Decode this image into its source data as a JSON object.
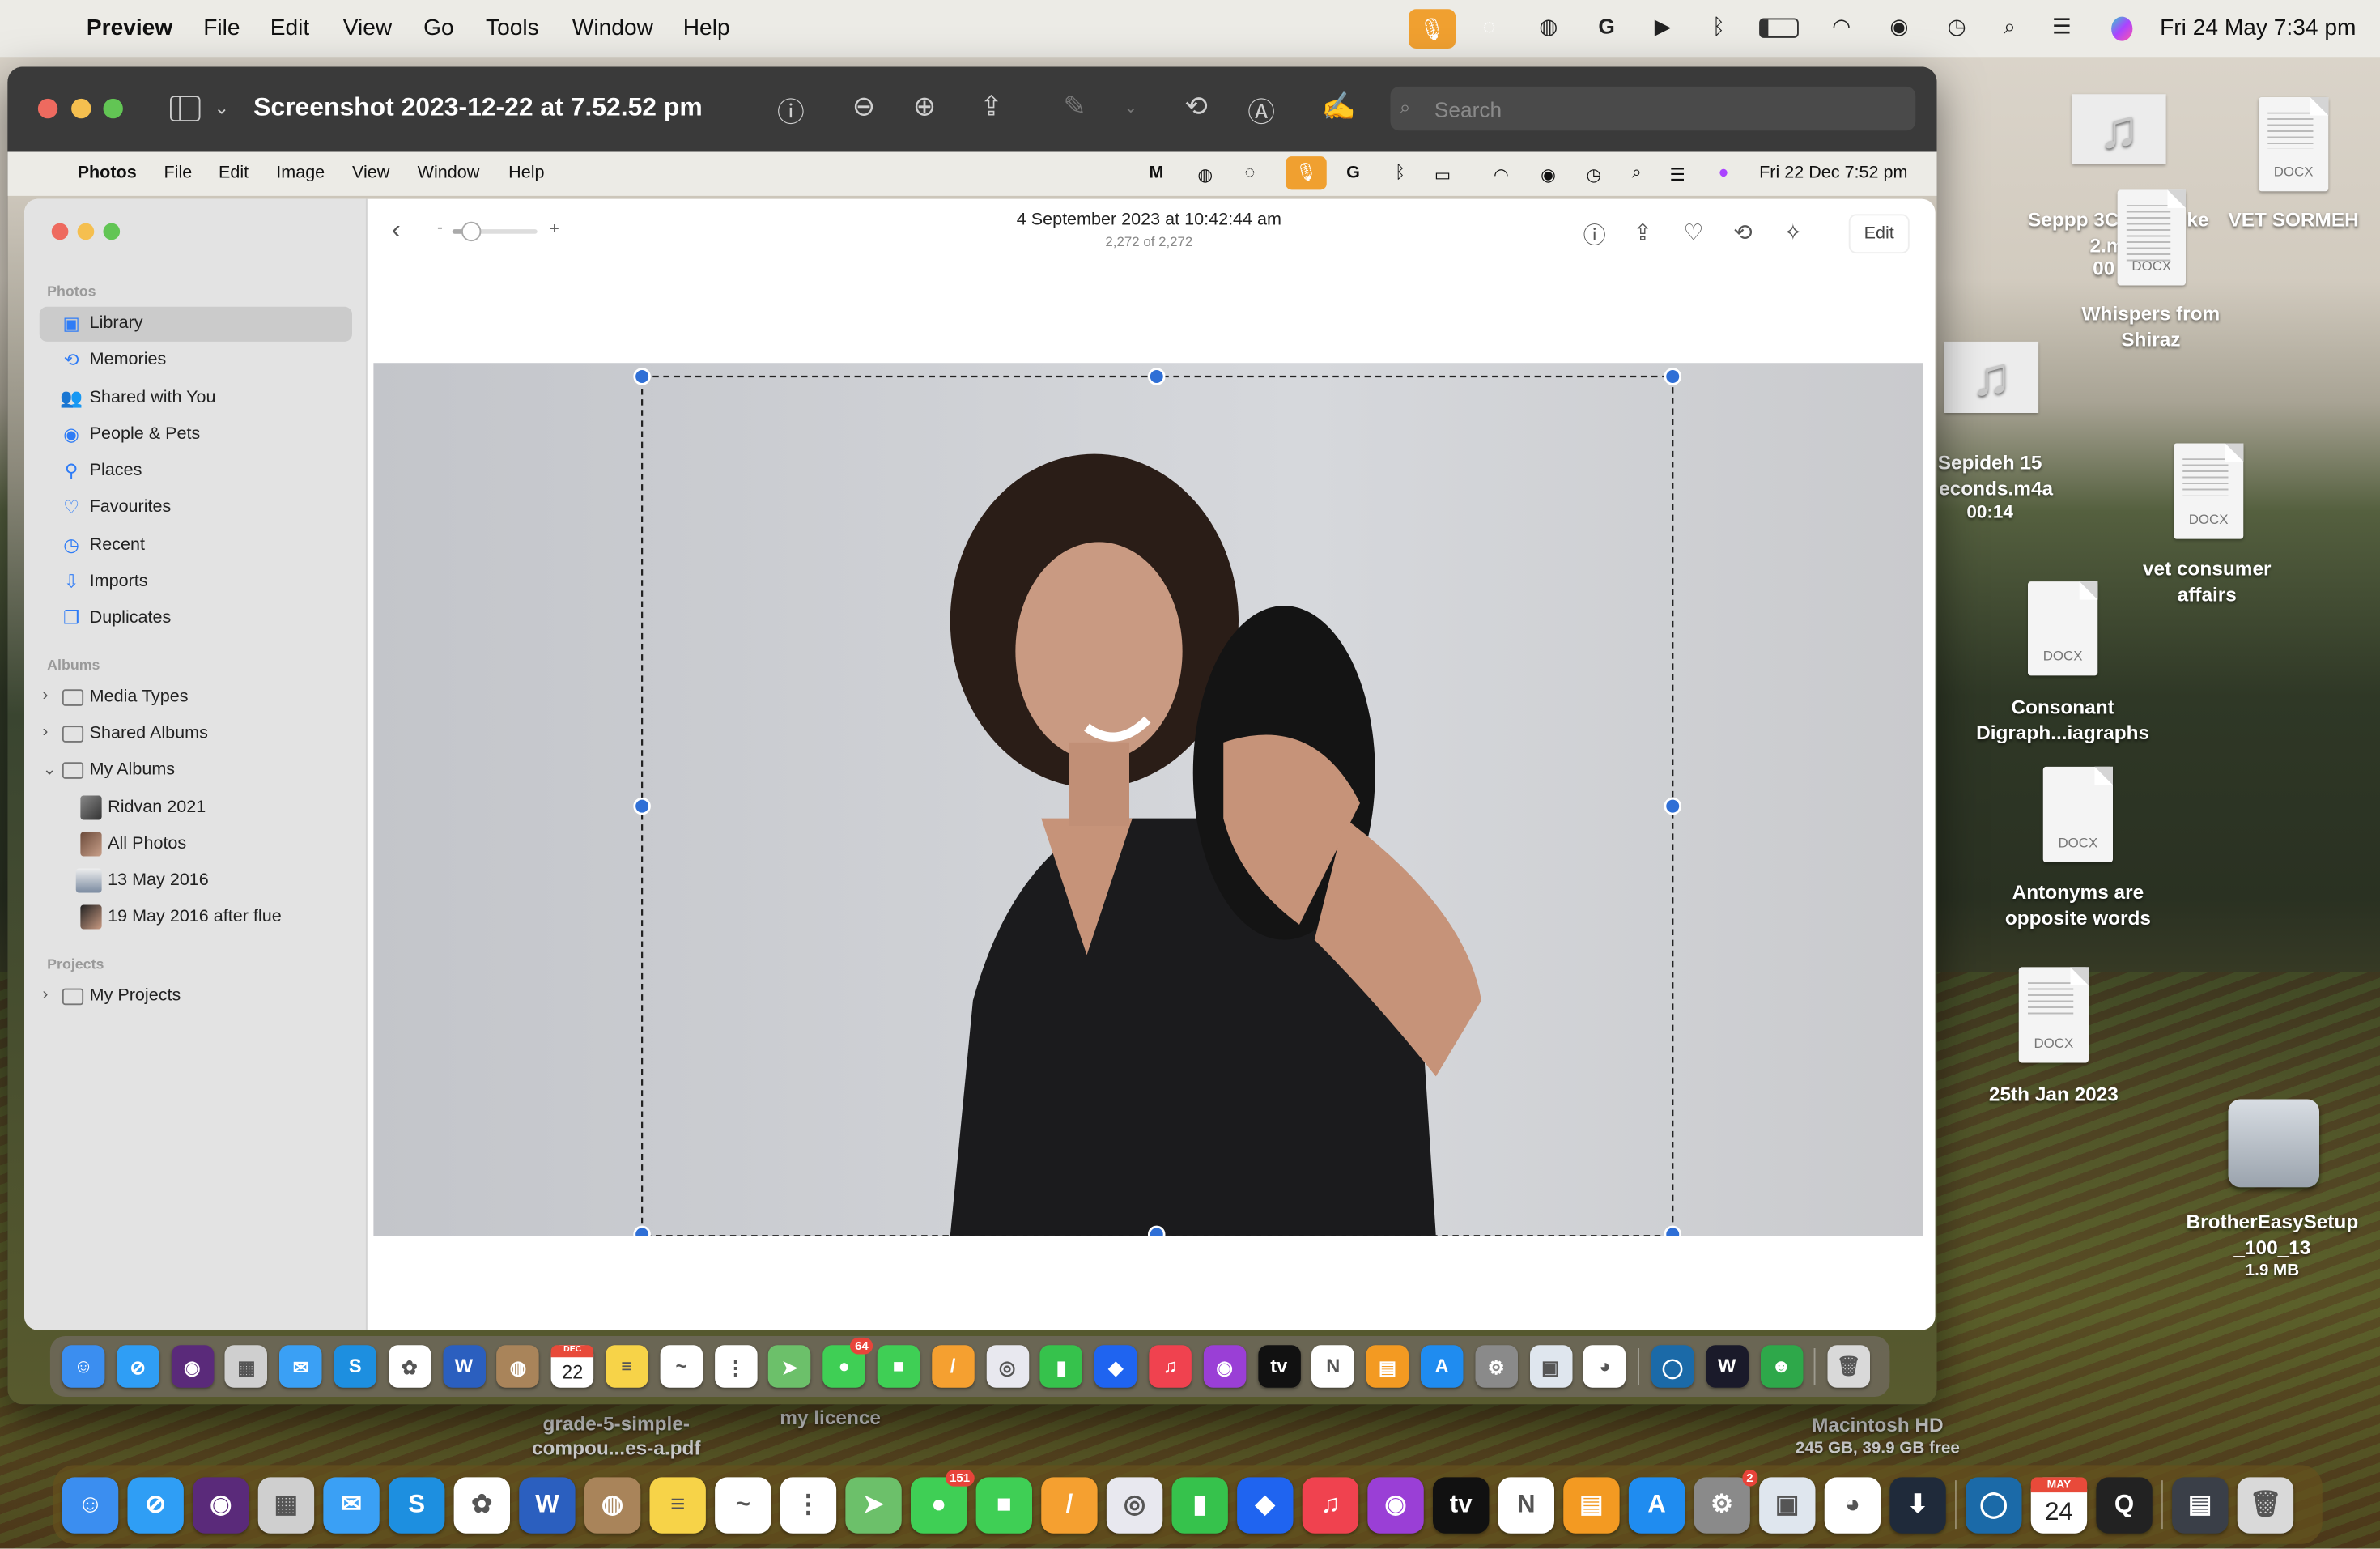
{
  "menubar": {
    "app": "Preview",
    "items": [
      "File",
      "Edit",
      "View",
      "Go",
      "Tools",
      "Window",
      "Help"
    ],
    "clock": "Fri 24 May  7:34 pm",
    "status_icons": [
      "microphone-icon",
      "circle-app-icon",
      "copilot-icon",
      "grammarly-icon",
      "play-icon",
      "bluetooth-icon",
      "battery-icon",
      "wifi-icon",
      "user-icon",
      "time-machine-icon",
      "search-icon",
      "control-center-icon",
      "siri-icon"
    ],
    "accent": "#f0a030"
  },
  "preview": {
    "title": "Screenshot 2023-12-22 at 7.52.52 pm",
    "search_placeholder": "Search",
    "toolbar_icons": [
      "info-icon",
      "zoom-out-icon",
      "zoom-in-icon",
      "share-icon",
      "markup-pen-icon",
      "chevron-down-icon",
      "rotate-icon",
      "annotate-icon",
      "signature-icon"
    ]
  },
  "inner_menubar": {
    "app": "Photos",
    "items": [
      "File",
      "Edit",
      "Image",
      "View",
      "Window",
      "Help"
    ],
    "clock": "Fri 22 Dec  7:52 pm"
  },
  "photos": {
    "header": {
      "date": "4 September 2023 at 10:42:44 am",
      "count": "2,272 of 2,272",
      "zoom_minus": "-",
      "zoom_plus": "+",
      "zoom_level": 0.2,
      "edit_label": "Edit"
    },
    "sidebar": {
      "photos_header": "Photos",
      "items": [
        {
          "label": "Library",
          "icon": "library-icon",
          "selected": true
        },
        {
          "label": "Memories",
          "icon": "memories-icon"
        },
        {
          "label": "Shared with You",
          "icon": "shared-with-you-icon"
        },
        {
          "label": "People & Pets",
          "icon": "people-icon"
        },
        {
          "label": "Places",
          "icon": "places-pin-icon"
        },
        {
          "label": "Favourites",
          "icon": "heart-icon"
        },
        {
          "label": "Recent",
          "icon": "clock-icon"
        },
        {
          "label": "Imports",
          "icon": "import-icon"
        },
        {
          "label": "Duplicates",
          "icon": "duplicates-icon"
        }
      ],
      "albums_header": "Albums",
      "albums": [
        {
          "label": "Media Types"
        },
        {
          "label": "Shared Albums"
        },
        {
          "label": "My Albums",
          "expanded": true
        }
      ],
      "my_albums": [
        {
          "label": "Ridvan 2021"
        },
        {
          "label": "All Photos"
        },
        {
          "label": "13 May 2016"
        },
        {
          "label": "19 May 2016 after flue"
        }
      ],
      "projects_header": "Projects",
      "projects": [
        {
          "label": "My Projects"
        }
      ]
    },
    "selection_color": "#2f6fd6"
  },
  "desktop": {
    "icons": [
      {
        "lines": [
          "Seppp 3C",
          "2.m",
          "00"
        ],
        "suffix": "ke",
        "type": "audio"
      },
      {
        "lines": [
          "VET SORMEH"
        ],
        "type": "docx",
        "badge": "DOCX"
      },
      {
        "lines": [
          "Whispers from",
          "Shiraz"
        ],
        "type": "docx",
        "badge": "DOCX"
      },
      {
        "lines": [
          "Sepideh 15",
          "econds.m4a",
          "00:14"
        ],
        "type": "audio"
      },
      {
        "lines": [
          "vet consumer",
          "affairs"
        ],
        "type": "docx",
        "badge": "DOCX"
      },
      {
        "lines": [
          "Consonant",
          "Digraph...iagraphs"
        ],
        "type": "docx",
        "badge": "DOCX"
      },
      {
        "lines": [
          "Antonyms are",
          "opposite words"
        ],
        "type": "docx",
        "badge": "DOCX"
      },
      {
        "lines": [
          "25th Jan 2023"
        ],
        "type": "docx",
        "badge": "DOCX"
      },
      {
        "lines": [
          "BrotherEasySetup",
          "_100_13",
          "1.9 MB"
        ],
        "type": "disk"
      },
      {
        "lines": [
          "grade-5-simple-",
          "compou...es-a.pdf"
        ],
        "type": "label"
      },
      {
        "lines": [
          "my licence"
        ],
        "type": "label"
      },
      {
        "lines": [
          "Macintosh HD",
          "245 GB, 39.9 GB free"
        ],
        "type": "label"
      }
    ]
  },
  "inner_dock": {
    "apps": [
      {
        "name": "finder",
        "color": "#3b8ef0",
        "glyph": "☺"
      },
      {
        "name": "safari",
        "color": "#2f9ef5",
        "glyph": "⊘"
      },
      {
        "name": "siri",
        "color": "#5a2a7a",
        "glyph": "◉"
      },
      {
        "name": "launchpad",
        "color": "#cfcfcf",
        "glyph": "▦"
      },
      {
        "name": "mail",
        "color": "#3aa0f5",
        "glyph": "✉"
      },
      {
        "name": "skype",
        "color": "#1d8fe0",
        "glyph": "S"
      },
      {
        "name": "photos",
        "color": "#ffffff",
        "glyph": "✿"
      },
      {
        "name": "word",
        "color": "#2b5fbf",
        "glyph": "W"
      },
      {
        "name": "contacts",
        "color": "#a9845a",
        "glyph": "◍"
      },
      {
        "name": "calendar",
        "color": "#ffffff",
        "glyph": "22",
        "top": "DEC"
      },
      {
        "name": "notes",
        "color": "#f7d348",
        "glyph": "≡"
      },
      {
        "name": "freeform",
        "color": "#ffffff",
        "glyph": "~"
      },
      {
        "name": "reminders",
        "color": "#ffffff",
        "glyph": "⋮"
      },
      {
        "name": "maps",
        "color": "#6cc06a",
        "glyph": "➤"
      },
      {
        "name": "messages",
        "color": "#3fcf55",
        "glyph": "●",
        "badge": "64"
      },
      {
        "name": "facetime",
        "color": "#3fcf55",
        "glyph": "■"
      },
      {
        "name": "pages",
        "color": "#f5a030",
        "glyph": "/"
      },
      {
        "name": "circle-app",
        "color": "#e8e8ef",
        "glyph": "◎"
      },
      {
        "name": "numbers",
        "color": "#36c24c",
        "glyph": "▮"
      },
      {
        "name": "dropbox",
        "color": "#1f64f0",
        "glyph": "◆"
      },
      {
        "name": "music",
        "color": "#f0424f",
        "glyph": "♫"
      },
      {
        "name": "podcasts",
        "color": "#9a3fd6",
        "glyph": "◉"
      },
      {
        "name": "tv",
        "color": "#111111",
        "glyph": "tv"
      },
      {
        "name": "news",
        "color": "#ffffff",
        "glyph": "N"
      },
      {
        "name": "books",
        "color": "#f39a22",
        "glyph": "▤"
      },
      {
        "name": "app-store",
        "color": "#1f8cf0",
        "glyph": "A"
      },
      {
        "name": "system-settings",
        "color": "#8a8a8a",
        "glyph": "⚙"
      },
      {
        "name": "preview",
        "color": "#dfe6ee",
        "glyph": "▣"
      },
      {
        "name": "chrome",
        "color": "#ffffff",
        "glyph": "◕"
      },
      {
        "sep": true
      },
      {
        "name": "edge",
        "color": "#1b6aa8",
        "glyph": "◯"
      },
      {
        "name": "webex",
        "color": "#1a1a2a",
        "glyph": "W"
      },
      {
        "name": "green-app",
        "color": "#2ea84a",
        "glyph": "☻"
      },
      {
        "sep": true
      },
      {
        "name": "trash",
        "color": "#d9d9d9",
        "glyph": "🗑"
      }
    ]
  },
  "dock": {
    "apps": [
      {
        "name": "finder",
        "color": "#3b8ef0",
        "glyph": "☺"
      },
      {
        "name": "safari",
        "color": "#2f9ef5",
        "glyph": "⊘"
      },
      {
        "name": "siri",
        "color": "#5a2a7a",
        "glyph": "◉"
      },
      {
        "name": "launchpad",
        "color": "#cfcfcf",
        "glyph": "▦"
      },
      {
        "name": "mail",
        "color": "#3aa0f5",
        "glyph": "✉"
      },
      {
        "name": "skype",
        "color": "#1d8fe0",
        "glyph": "S"
      },
      {
        "name": "photos",
        "color": "#ffffff",
        "glyph": "✿"
      },
      {
        "name": "word",
        "color": "#2b5fbf",
        "glyph": "W"
      },
      {
        "name": "contacts",
        "color": "#a9845a",
        "glyph": "◍"
      },
      {
        "name": "notes",
        "color": "#f7d348",
        "glyph": "≡"
      },
      {
        "name": "freeform",
        "color": "#ffffff",
        "glyph": "~"
      },
      {
        "name": "reminders",
        "color": "#ffffff",
        "glyph": "⋮"
      },
      {
        "name": "maps",
        "color": "#6cc06a",
        "glyph": "➤"
      },
      {
        "name": "messages",
        "color": "#3fcf55",
        "glyph": "●",
        "badge": "151"
      },
      {
        "name": "facetime",
        "color": "#3fcf55",
        "glyph": "■"
      },
      {
        "name": "pages",
        "color": "#f5a030",
        "glyph": "/"
      },
      {
        "name": "circle-app",
        "color": "#e8e8ef",
        "glyph": "◎"
      },
      {
        "name": "numbers",
        "color": "#36c24c",
        "glyph": "▮"
      },
      {
        "name": "dropbox",
        "color": "#1f64f0",
        "glyph": "◆"
      },
      {
        "name": "music",
        "color": "#f0424f",
        "glyph": "♫"
      },
      {
        "name": "podcasts",
        "color": "#9a3fd6",
        "glyph": "◉"
      },
      {
        "name": "tv",
        "color": "#111111",
        "glyph": "tv"
      },
      {
        "name": "news",
        "color": "#ffffff",
        "glyph": "N"
      },
      {
        "name": "books",
        "color": "#f39a22",
        "glyph": "▤"
      },
      {
        "name": "app-store",
        "color": "#1f8cf0",
        "glyph": "A"
      },
      {
        "name": "system-settings",
        "color": "#8a8a8a",
        "glyph": "⚙",
        "badge": "2"
      },
      {
        "name": "preview",
        "color": "#dfe6ee",
        "glyph": "▣"
      },
      {
        "name": "chrome",
        "color": "#ffffff",
        "glyph": "◕"
      },
      {
        "name": "downloader",
        "color": "#1f2a3a",
        "glyph": "⬇"
      },
      {
        "sep": true
      },
      {
        "name": "edge",
        "color": "#1b6aa8",
        "glyph": "◯"
      },
      {
        "name": "calendar",
        "color": "#ffffff",
        "glyph": "24",
        "top": "MAY"
      },
      {
        "name": "quicktime",
        "color": "#222222",
        "glyph": "Q"
      },
      {
        "sep": true
      },
      {
        "name": "downloads-stack",
        "color": "#3a3f48",
        "glyph": "▤"
      },
      {
        "name": "trash",
        "color": "#d9d9d9",
        "glyph": "🗑"
      }
    ]
  }
}
